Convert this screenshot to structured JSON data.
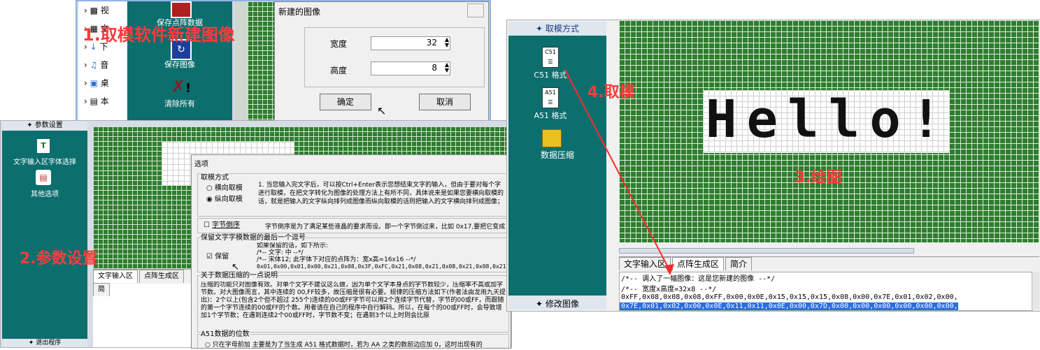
{
  "step1": {
    "label": "1.取模软件新建图像",
    "toolbar_items": [
      {
        "label": "保存点阵数据",
        "icon": "save-dot-data-icon"
      },
      {
        "label": "保存图像",
        "icon": "save-image-icon"
      },
      {
        "label": "清除所有",
        "icon": "clear-all-icon"
      }
    ],
    "tree_items": [
      "视",
      "文",
      "下",
      "音",
      "桌",
      "本"
    ],
    "dialog": {
      "title": "新建的图像",
      "width_label": "宽度",
      "width_value": "32",
      "height_label": "高度",
      "height_value": "8",
      "ok": "确定",
      "cancel": "取消"
    }
  },
  "step2": {
    "label": "2.参数设置",
    "sidebar_header": "参数设置",
    "sidebar_items": [
      {
        "label": "文字输入区字体选择",
        "icon": "font-select-icon"
      },
      {
        "label": "其他选项",
        "icon": "other-options-icon"
      }
    ],
    "sidebar_footer": "退出程序",
    "tabs": [
      "文字输入区",
      "点阵生成区",
      "简"
    ],
    "options": {
      "title": "选项",
      "group_scan": "取模方式",
      "radio_horizontal": "横向取模",
      "radio_vertical": "纵向取模",
      "scan_desc": "1. 当您输入完文字后，可以按Ctrl+Enter表示您想结束文字的输入，但由于要对每个字进行取模，在把文字转化为图像的处理方法上有所不同，具体说来是如果您要横向取模的话，就是把输入的文字纵向排列成图像而纵向取模的话则把输入的文字横向排列成图像；",
      "byte_reverse": "字节倒序",
      "byte_reverse_desc": "字节倒序是为了满足某些液晶的要求而设。即一个字节倒过来，比如 0x17,要把它变成",
      "keep_group": "保留文字字模数据的最后一个逗号",
      "keep_label": "保留",
      "keep_desc_1": "如果保留的话，如下所示:",
      "keep_desc_2": "/*--  文字:  中  --*/",
      "keep_desc_3": "/*--  宋体12;  此字体下对应的点阵为：宽x高=16x16   --*/",
      "keep_desc_4": "0x01,0x00,0x01,0x00,0x21,0x08,0x3F,0xFC,0x21,0x08,0x21,0x08,0x21,0x08,0x21,0x0",
      "compress_group": "关于数据压缩的一点说明",
      "compress_desc": "压缩的功能只对图像有效。对单个文字不建议这么做，因为单个文字本身点的字节数较少，压缩率不高或加字节数。对大图像而言，其中连续的 00,FF较多，故压缩是很有必要。规律的压缩方法如下(作者法由龙雨九天提出)：2个以上(包含2个但不超过 255个)连续的00或FF字节可以用2个连续字节代替，字节的00或FF，而跟随的第一个字节连续的00或FF的个数。用者请在自己的程序中自行解码。所以，在每个的00或FF时，会导致增加1个字节数；在遇到连续2个00或FF时，字节数不变；在遇到3个以上时则会比原",
      "a51_group": "A51数据的位数",
      "a51_desc": "只在字母前加 主要是为了当生成 A51 格式数据时，若为 AA 之类的数前边应加 0，这时出现有的"
    }
  },
  "step3": {
    "label": "3.绘图",
    "hello_text": "Hello!"
  },
  "step4": {
    "label": "4.取模",
    "sidebar_header": "取模方式",
    "sidebar_items": [
      {
        "label": "C51 格式",
        "icon": "c51-format-icon"
      },
      {
        "label": "A51 格式",
        "icon": "a51-format-icon"
      },
      {
        "label": "数据压缩",
        "icon": "data-compress-icon"
      }
    ],
    "sidebar_footer": "修改图像",
    "tabs": [
      "文字输入区",
      "点阵生成区",
      "简介"
    ],
    "output_lines": [
      "/*--  调入了一幅图像：这是您新建的图像  --*/",
      "/*--  宽度x高度=32x8  --*/",
      "0xFF,0x08,0x08,0x08,0xFF,0x00,0x0E,0x15,0x15,0x15,0x08,0x00,0x7E,0x01,0x02,0x00,",
      "0x7E,0x01,0x02,0x00,0x0E,0x11,0x11,0x0E,0x00,0x7D,0x00,0x00,0x00,0x00,0x00,0x00,"
    ]
  }
}
